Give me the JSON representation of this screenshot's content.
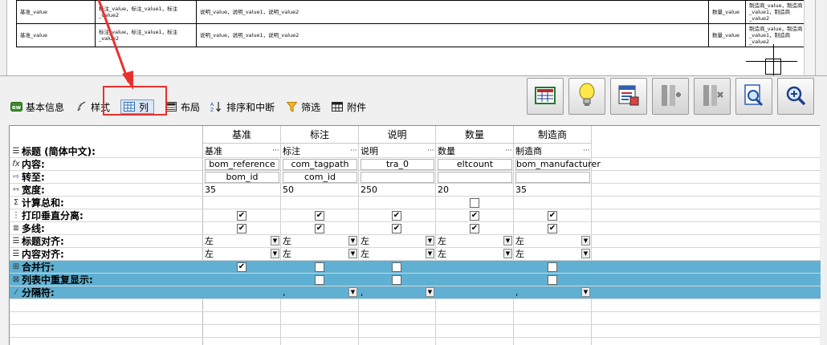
{
  "preview": {
    "rows": [
      {
        "c1": "基准_value",
        "c2": "标注_value，标注_value1，标注_value2",
        "c3": "说明_value，说明_value1，说明_value2",
        "c4": "数量_value",
        "c5": "制造商_value，制造商_value1，制造商_value2"
      },
      {
        "c1": "基准_value",
        "c2": "标注_value，标注_value1，标注_value2",
        "c3": "说明_value，说明_value1，说明_value2",
        "c4": "数量_value",
        "c5": "制造商_value，制造商_value1，制造商_value2"
      }
    ]
  },
  "tabs": [
    {
      "label": "基本信息",
      "icon": "info-icon"
    },
    {
      "label": "样式",
      "icon": "style-brush-icon"
    },
    {
      "label": "列",
      "icon": "columns-icon",
      "active": true
    },
    {
      "label": "布局",
      "icon": "layout-icon"
    },
    {
      "label": "排序和中断",
      "icon": "sort-icon"
    },
    {
      "label": "筛选",
      "icon": "filter-icon"
    },
    {
      "label": "附件",
      "icon": "attachment-icon"
    }
  ],
  "toolbar": [
    {
      "name": "table-button",
      "icon": "table-icon"
    },
    {
      "name": "bulb-button",
      "icon": "lightbulb-icon"
    },
    {
      "name": "properties-button",
      "icon": "properties-icon"
    },
    {
      "name": "insert-column-button",
      "icon": "insert-column-icon",
      "disabled": true
    },
    {
      "name": "delete-column-button",
      "icon": "delete-column-icon",
      "disabled": true
    },
    {
      "name": "preview-button",
      "icon": "document-search-icon"
    },
    {
      "name": "zoom-button",
      "icon": "zoom-icon"
    }
  ],
  "grid": {
    "columns": [
      "基准",
      "标注",
      "说明",
      "数量",
      "制造商"
    ],
    "row_labels": {
      "title": "标题 (简体中文):",
      "content": "内容:",
      "goto": "转至:",
      "width": "宽度:",
      "sum": "计算总和:",
      "print_split": "打印垂直分离:",
      "multiline": "多线:",
      "title_align": "标题对齐:",
      "content_align": "内容对齐:",
      "merge": "合并行:",
      "repeat": "列表中重复显示:",
      "separator": "分隔符:"
    },
    "titles": [
      "基准",
      "标注",
      "说明",
      "数量",
      "制造商"
    ],
    "contents": [
      "bom_reference",
      "com_tagpath",
      "tra_0",
      "eltcount",
      "bom_manufacturer"
    ],
    "gotos": [
      "bom_id",
      "com_id",
      "",
      "",
      ""
    ],
    "widths": [
      "35",
      "50",
      "250",
      "20",
      "35"
    ],
    "title_aligns": [
      "左",
      "左",
      "左",
      "左",
      "左"
    ],
    "content_aligns": [
      "左",
      "左",
      "左",
      "左",
      "左"
    ],
    "separators": [
      "",
      ",",
      ",",
      "",
      ","
    ]
  }
}
